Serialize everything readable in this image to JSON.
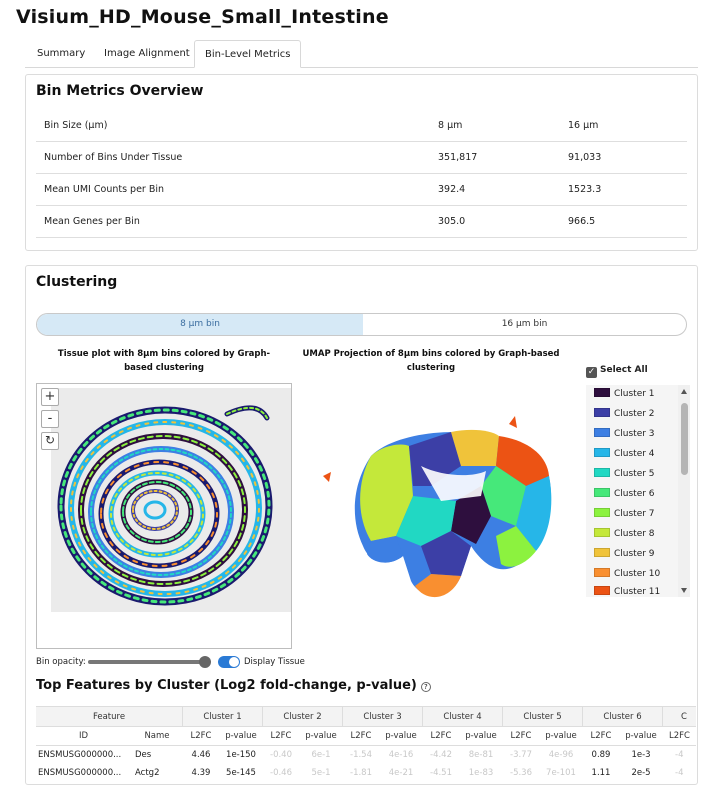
{
  "page": {
    "title": "Visium_HD_Mouse_Small_Intestine"
  },
  "tabs": [
    {
      "label": "Summary"
    },
    {
      "label": "Image Alignment"
    },
    {
      "label": "Bin-Level Metrics"
    }
  ],
  "metrics": {
    "title": "Bin Metrics Overview",
    "rows": [
      {
        "label": "Bin Size (µm)",
        "v8": "8 µm",
        "v16": "16 µm"
      },
      {
        "label": "Number of Bins Under Tissue",
        "v8": "351,817",
        "v16": "91,033"
      },
      {
        "label": "Mean UMI Counts per Bin",
        "v8": "392.4",
        "v16": "1523.3"
      },
      {
        "label": "Mean Genes per Bin",
        "v8": "305.0",
        "v16": "966.5"
      }
    ]
  },
  "clustering": {
    "title": "Clustering",
    "toggle": {
      "opt1": "8 µm bin",
      "opt2": "16 µm bin"
    },
    "tissue_plot_title": "Tissue plot with 8µm bins colored by Graph-based clustering",
    "umap_title": "UMAP Projection of 8µm bins colored by Graph-based clustering",
    "zoom": {
      "plus": "+",
      "minus": "-",
      "reset": "↻"
    },
    "select_all": "Select All",
    "clusters": [
      {
        "label": "Cluster 1",
        "color": "#2e0f3e"
      },
      {
        "label": "Cluster 2",
        "color": "#3c3fa6"
      },
      {
        "label": "Cluster 3",
        "color": "#3d7fe3"
      },
      {
        "label": "Cluster 4",
        "color": "#26b6e8"
      },
      {
        "label": "Cluster 5",
        "color": "#21d8c3"
      },
      {
        "label": "Cluster 6",
        "color": "#46e87a"
      },
      {
        "label": "Cluster 7",
        "color": "#8cf23f"
      },
      {
        "label": "Cluster 8",
        "color": "#c4e83a"
      },
      {
        "label": "Cluster 9",
        "color": "#f0c33a"
      },
      {
        "label": "Cluster 10",
        "color": "#f98f30"
      },
      {
        "label": "Cluster 11",
        "color": "#ec5314"
      }
    ],
    "opacity_label": "Bin opacity:",
    "display_tissue_label": "Display Tissue"
  },
  "features": {
    "title": "Top Features by Cluster (Log2 fold-change, p-value)",
    "help": "?",
    "feature_header": "Feature",
    "id_header": "ID",
    "name_header": "Name",
    "l2fc_header": "L2FC",
    "pval_header": "p-value",
    "cluster_headers": [
      "Cluster 1",
      "Cluster 2",
      "Cluster 3",
      "Cluster 4",
      "Cluster 5",
      "Cluster 6",
      "C"
    ],
    "rows": [
      {
        "id": "ENSMUSG000000...",
        "name": "Des",
        "vals": [
          "4.46",
          "1e-150",
          "-0.40",
          "6e-1",
          "-1.54",
          "4e-16",
          "-4.42",
          "8e-81",
          "-3.77",
          "4e-96",
          "0.89",
          "1e-3",
          "-4"
        ]
      },
      {
        "id": "ENSMUSG000000...",
        "name": "Actg2",
        "vals": [
          "4.39",
          "5e-145",
          "-0.46",
          "5e-1",
          "-1.81",
          "4e-21",
          "-4.51",
          "1e-83",
          "-5.36",
          "7e-101",
          "1.11",
          "2e-5",
          "-4"
        ]
      }
    ]
  }
}
